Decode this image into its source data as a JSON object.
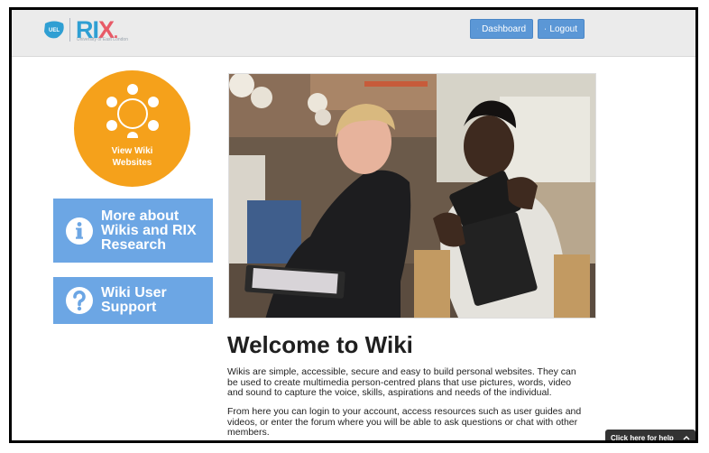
{
  "header": {
    "logo": {
      "brand_r": "R",
      "brand_i": "I",
      "brand_x": "X",
      "brand_dot": ".",
      "badge": "UEL",
      "subtext": "University of East London"
    },
    "buttons": [
      {
        "label": "Dashboard",
        "icon": "cogs-icon"
      },
      {
        "label": "Logout",
        "icon": "lock-icon"
      }
    ]
  },
  "sidebar": {
    "view_wiki": {
      "line1": "View Wiki",
      "line2": "Websites",
      "icon": "network-icon"
    },
    "more_about": {
      "line1": "More about",
      "line2": "Wikis and RIX",
      "line3": "Research",
      "icon": "info-icon"
    },
    "support": {
      "line1": "Wiki User",
      "line2": "Support",
      "icon": "question-icon"
    }
  },
  "main": {
    "title": "Welcome to Wiki",
    "paragraph1": "Wikis are simple, accessible, secure and easy to build personal websites. They can be used to create multimedia person-centred plans that use pictures, words, video and sound to capture the voice, skills, aspirations and needs of the individual.",
    "paragraph2": "From here you can login to your account, access resources such as user guides and videos, or enter the forum where you will be able to ask questions or chat with other members."
  },
  "help_widget": {
    "label": "Click here for help",
    "icon": "chevron-up-icon"
  },
  "colors": {
    "accent_blue": "#6ca6e4",
    "header_button": "#5b97d6",
    "orange": "#f5a11b",
    "brand_blue": "#2f9fd3",
    "brand_red": "#e85a67"
  }
}
